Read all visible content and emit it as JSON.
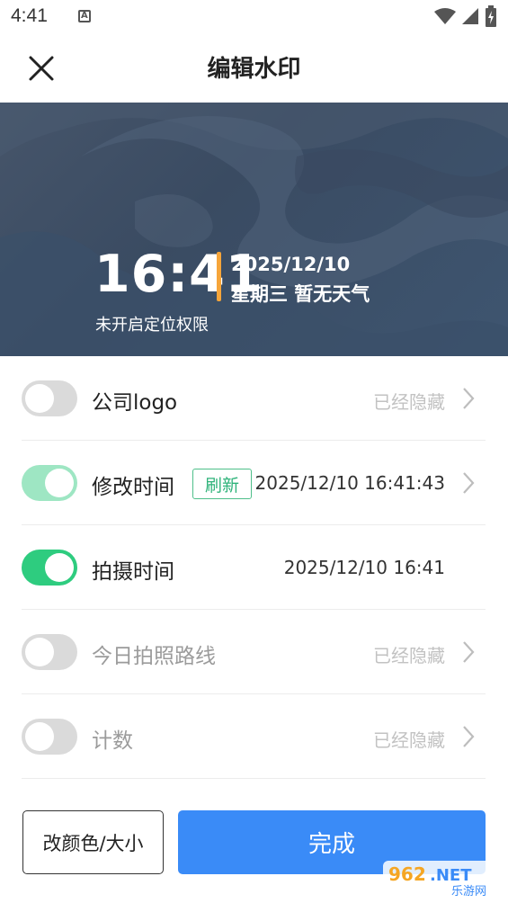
{
  "status_bar": {
    "time": "4:41",
    "notification_glyph": "A"
  },
  "header": {
    "title": "编辑水印",
    "close_icon": "close-icon"
  },
  "preview": {
    "time": "16:41",
    "date": "2025/12/10",
    "weekday_weather": "星期三  暂无天气",
    "location": "未开启定位权限",
    "accent_color": "#f6a53a"
  },
  "settings": [
    {
      "label": "公司logo",
      "enabled": false,
      "value": "已经隐藏"
    },
    {
      "label": "修改时间",
      "enabled": true,
      "refresh_label": "刷新",
      "value": "2025/12/10 16:41:43"
    },
    {
      "label": "拍摄时间",
      "enabled": true,
      "value": "2025/12/10 16:41"
    },
    {
      "label": "今日拍照路线",
      "enabled": false,
      "value": "已经隐藏"
    },
    {
      "label": "计数",
      "enabled": false,
      "value": "已经隐藏"
    }
  ],
  "footer": {
    "color_size_label": "改颜色/大小",
    "done_label": "完成"
  },
  "watermark": {
    "text": "962.NET 乐游网"
  },
  "colors": {
    "toggle_on": "#2ecc7f",
    "toggle_on_light": "#9ee6c3",
    "primary": "#3a8bf7"
  }
}
